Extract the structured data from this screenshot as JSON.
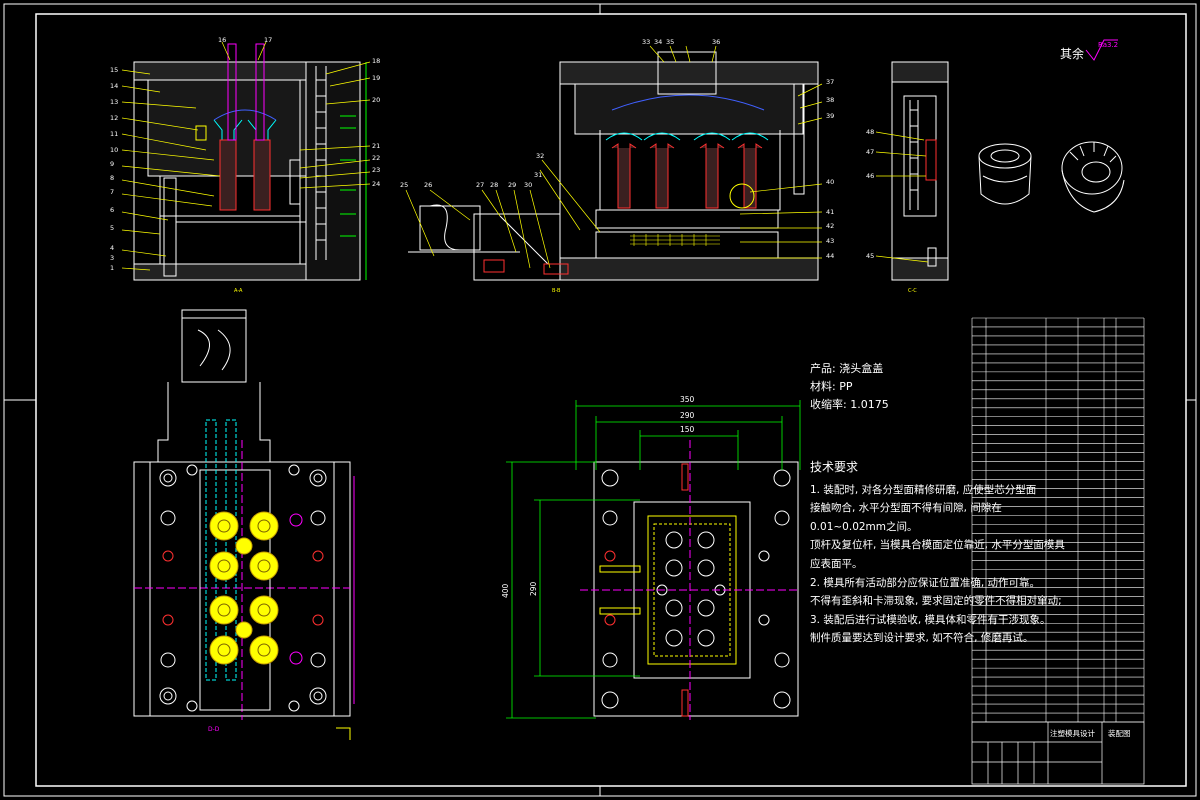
{
  "roughness": {
    "label": "其余",
    "value": "Ra3.2"
  },
  "views": {
    "a_a": "A-A",
    "b_b": "B-B",
    "c_c": "C-C"
  },
  "product_info": {
    "product": "产品: 浇头盒盖",
    "material": "材料: PP",
    "shrinkage": "收缩率: 1.0175"
  },
  "tech_requirements": {
    "title": "技术要求",
    "lines": [
      "1. 装配时, 对各分型面精修研磨, 应使型芯分型面",
      "接触吻合, 水平分型面不得有间隙, 间隙在",
      "0.01~0.02mm之间。",
      "顶杆及复位杆, 当模具合模面定位靠近, 水平分型面模具",
      "应表面平。",
      "2. 模具所有活动部分应保证位置准确, 动作可靠。",
      "不得有歪斜和卡滞现象, 要求固定的零件不得相对窜动;",
      "3. 装配后进行试模验收, 模具体和零件有干涉现象。",
      "制件质量要达到设计要求, 如不符合, 修磨再试。"
    ]
  },
  "dimensions": {
    "w350": "350",
    "w290": "290",
    "w150": "150",
    "h400": "400",
    "h290": "290"
  },
  "section_label": "D-D",
  "part_numbers": {
    "left_view": [
      "1",
      "2",
      "3",
      "4",
      "5",
      "6",
      "7",
      "8",
      "9",
      "10",
      "11",
      "12",
      "13",
      "14",
      "15"
    ],
    "top_left": [
      "16",
      "17"
    ],
    "right_of_left": [
      "18",
      "19",
      "20",
      "21",
      "22",
      "23",
      "24"
    ],
    "top_mid": [
      "33",
      "34",
      "35",
      "36"
    ],
    "mid_left": [
      "25",
      "26",
      "27",
      "28",
      "29",
      "30",
      "31",
      "32"
    ],
    "mid_right": [
      "37",
      "38",
      "39",
      "40",
      "41",
      "42",
      "43",
      "44"
    ],
    "right_view": [
      "45",
      "46",
      "47",
      "48"
    ]
  },
  "title_block": {
    "name": "注塑模具设计",
    "drawing": "装配图"
  },
  "colors": {
    "line": "#ffffff",
    "yellow": "#ffff00",
    "cyan": "#00ffff",
    "green": "#00ff00",
    "magenta": "#ff00ff",
    "red": "#ff3030",
    "blue": "#4060ff"
  }
}
